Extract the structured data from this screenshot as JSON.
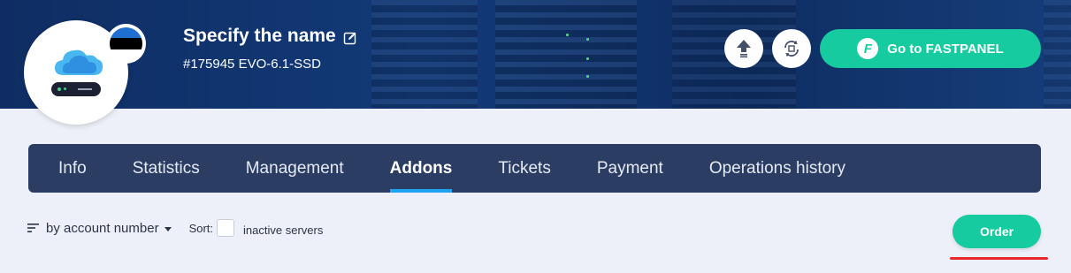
{
  "server": {
    "name": "Specify the name",
    "id_line": "#175945 EVO-6.1-SSD",
    "flag_colors": [
      "#1f6fd0",
      "#000000",
      "#ffffff"
    ]
  },
  "actions": {
    "fastpanel_label": "Go to FASTPANEL",
    "fastpanel_logo_letter": "F",
    "upload_icon": "upload-arrow-icon",
    "reinstall_icon": "refresh-icon"
  },
  "tabs": [
    {
      "label": "Info",
      "active": false
    },
    {
      "label": "Statistics",
      "active": false
    },
    {
      "label": "Management",
      "active": false
    },
    {
      "label": "Addons",
      "active": true
    },
    {
      "label": "Tickets",
      "active": false
    },
    {
      "label": "Payment",
      "active": false
    },
    {
      "label": "Operations history",
      "active": false
    }
  ],
  "toolbar": {
    "sort_by_label": "by account number",
    "sort_label": "Sort:",
    "inactive_label": "inactive servers",
    "order_label": "Order"
  },
  "colors": {
    "accent": "#16cba0",
    "tab_bg": "#2b3d63",
    "active_tab_underline": "#1fa3f0",
    "highlight_line": "#e8262b"
  }
}
